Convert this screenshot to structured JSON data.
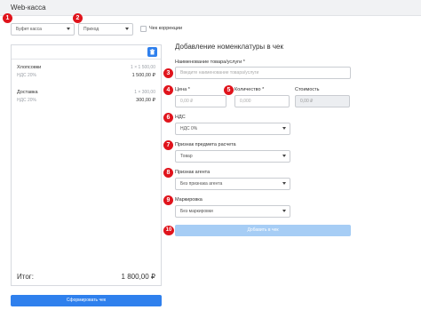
{
  "app": {
    "title": "Web-касса"
  },
  "markers": [
    "1",
    "2",
    "3",
    "4",
    "5",
    "6",
    "7",
    "8",
    "9",
    "10"
  ],
  "toolbar": {
    "register_value": "Буфет касса",
    "operation_value": "Приход",
    "correction_label": "Чек коррекции"
  },
  "cart": {
    "items": [
      {
        "name": "Хлопсовки",
        "qty": "1 × 1 500,00",
        "vat": "НДС 20%",
        "sum": "1 500,00 ₽"
      },
      {
        "name": "Доставка",
        "qty": "1 × 300,00",
        "vat": "НДС 20%",
        "sum": "300,00 ₽"
      }
    ],
    "total_label": "Итог:",
    "total_value": "1 800,00 ₽",
    "submit_label": "Сформировать чек"
  },
  "form": {
    "title": "Добавление номенклатуры в чек",
    "name_label": "Наименование товара/услуги *",
    "name_placeholder": "Введите наименование товара/услуги",
    "price_label": "Цена *",
    "price_placeholder": "0,00 ₽",
    "qty_label": "Количество *",
    "qty_placeholder": "0,000",
    "cost_label": "Стоимость",
    "cost_value": "0,00 ₽",
    "vat_label": "НДС",
    "vat_value": "НДС 0%",
    "subject_label": "Признак предмета расчета",
    "subject_value": "Товар",
    "agent_label": "Признак агента",
    "agent_value": "Без признака агента",
    "marking_label": "Маркировка",
    "marking_value": "Без маркировки",
    "add_label": "Добавить в чек"
  }
}
